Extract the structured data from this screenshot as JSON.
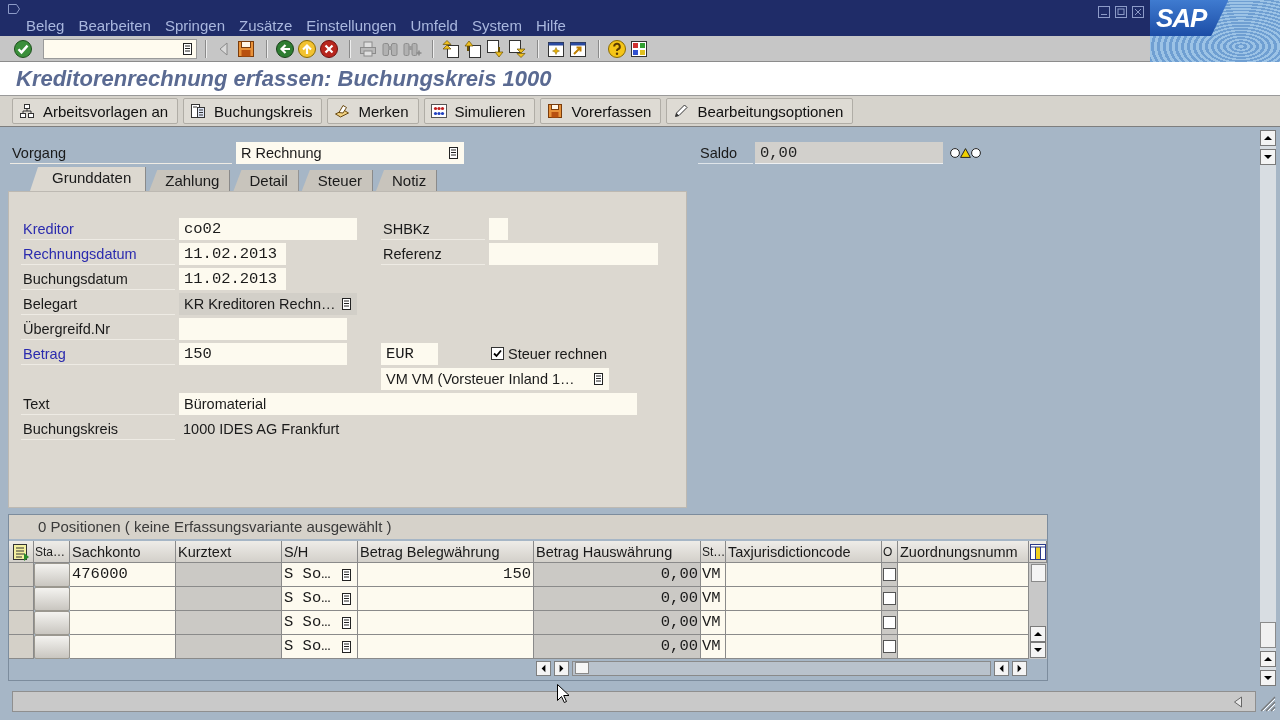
{
  "window": {
    "menu": [
      "Beleg",
      "Bearbeiten",
      "Springen",
      "Zusätze",
      "Einstellungen",
      "Umfeld",
      "System",
      "Hilfe"
    ],
    "logo": "SAP"
  },
  "toolbar": {
    "items": [
      {
        "kind": "enter",
        "disabled": false
      },
      {
        "kind": "command_field"
      },
      {
        "kind": "separator"
      },
      {
        "kind": "collapse",
        "disabled": true
      },
      {
        "kind": "save",
        "disabled": false
      },
      {
        "kind": "separator"
      },
      {
        "kind": "back",
        "disabled": false
      },
      {
        "kind": "exit",
        "disabled": false
      },
      {
        "kind": "cancel",
        "disabled": false
      },
      {
        "kind": "separator"
      },
      {
        "kind": "print",
        "disabled": true
      },
      {
        "kind": "find",
        "disabled": true
      },
      {
        "kind": "find_next",
        "disabled": true
      },
      {
        "kind": "separator"
      },
      {
        "kind": "first_page",
        "disabled": false
      },
      {
        "kind": "prev_page",
        "disabled": false
      },
      {
        "kind": "next_page",
        "disabled": false
      },
      {
        "kind": "last_page",
        "disabled": false
      },
      {
        "kind": "separator"
      },
      {
        "kind": "new_session",
        "disabled": false
      },
      {
        "kind": "shortcut",
        "disabled": false
      },
      {
        "kind": "separator"
      },
      {
        "kind": "help",
        "disabled": false
      },
      {
        "kind": "layout",
        "disabled": false
      }
    ]
  },
  "title": "Kreditorenrechnung erfassen: Buchungskreis 1000",
  "app_toolbar": [
    {
      "kind": "worklist",
      "label": "Arbeitsvorlagen an"
    },
    {
      "kind": "company_code",
      "label": "Buchungskreis"
    },
    {
      "kind": "hold",
      "label": "Merken"
    },
    {
      "kind": "simulate",
      "label": "Simulieren"
    },
    {
      "kind": "park",
      "label": "Vorerfassen"
    },
    {
      "kind": "options",
      "label": "Bearbeitungsoptionen"
    }
  ],
  "header": {
    "transaction": {
      "label": "Vorgang",
      "value": "R Rechnung"
    },
    "balance": {
      "label": "Saldo",
      "value": "0,00",
      "lights": [
        {
          "lit": false
        },
        {
          "lit": true
        },
        {
          "lit": false
        }
      ]
    }
  },
  "tabs": [
    {
      "label": "Grunddaten",
      "selected": true
    },
    {
      "label": "Zahlung",
      "selected": false
    },
    {
      "label": "Detail",
      "selected": false
    },
    {
      "label": "Steuer",
      "selected": false
    },
    {
      "label": "Notiz",
      "selected": false
    }
  ],
  "form": {
    "rows": [
      {
        "items": [
          {
            "kind": "label",
            "text": "Kreditor",
            "required": true
          },
          {
            "kind": "input",
            "value": "co02"
          },
          {
            "kind": "label",
            "text": "SHBKz",
            "required": false
          },
          {
            "kind": "input"
          }
        ]
      },
      {
        "items": [
          {
            "kind": "label",
            "text": "Rechnungsdatum",
            "required": true
          },
          {
            "kind": "input",
            "value": "11.02.2013"
          },
          {
            "kind": "label",
            "text": "Referenz",
            "required": false
          },
          {
            "kind": "input"
          }
        ]
      },
      {
        "items": [
          {
            "kind": "label",
            "text": "Buchungsdatum",
            "required": false
          },
          {
            "kind": "input",
            "value": "11.02.2013"
          }
        ]
      },
      {
        "items": [
          {
            "kind": "label",
            "text": "Belegart",
            "required": false
          },
          {
            "kind": "dropdown",
            "value": "KR Kreditoren Rechn…",
            "read_only": true
          }
        ]
      },
      {
        "items": [
          {
            "kind": "label",
            "text": "Übergreifd.Nr",
            "required": false
          },
          {
            "kind": "input"
          }
        ]
      },
      {
        "items": [
          {
            "kind": "label",
            "text": "Betrag",
            "required": true
          },
          {
            "kind": "input",
            "value": "150"
          },
          {
            "kind": "input",
            "value": "EUR"
          },
          {
            "kind": "checkbox",
            "label": "Steuer rechnen",
            "checked": true
          }
        ]
      },
      {
        "items": [
          {
            "kind": "dropdown",
            "value": "VM VM (Vorsteuer Inland 1…",
            "read_only": false
          }
        ]
      },
      {
        "items": [
          {
            "kind": "label",
            "text": "Text",
            "required": false
          },
          {
            "kind": "text_input",
            "value": "Büromaterial"
          }
        ]
      },
      {
        "items": [
          {
            "kind": "label",
            "text": "Buchungskreis",
            "required": false
          },
          {
            "kind": "display",
            "value": "1000 IDES AG Frankfurt"
          }
        ]
      }
    ]
  },
  "items_table": {
    "title": "0 Positionen ( keine Erfassungsvariante ausgewählt )",
    "columns": [
      "Sta…",
      "Sachkonto",
      "Kurztext",
      "S/H",
      "Betrag Belegwährung",
      "Betrag Hauswährung",
      "St…",
      "Taxjurisdictioncode",
      "O",
      "Zuordnungsnumm"
    ],
    "rows": [
      {
        "sachkonto": "476000",
        "s_h": "S So…",
        "betrag_belegwaehrung": "150",
        "betrag_hauswaehrung": "0,00",
        "st": "VM",
        "o": false
      },
      {
        "s_h": "S So…",
        "betrag_hauswaehrung": "0,00",
        "st": "VM",
        "o": false
      },
      {
        "s_h": "S So…",
        "betrag_hauswaehrung": "0,00",
        "st": "VM",
        "o": false
      },
      {
        "s_h": "S So…",
        "betrag_hauswaehrung": "0,00",
        "st": "VM",
        "o": false
      }
    ]
  }
}
